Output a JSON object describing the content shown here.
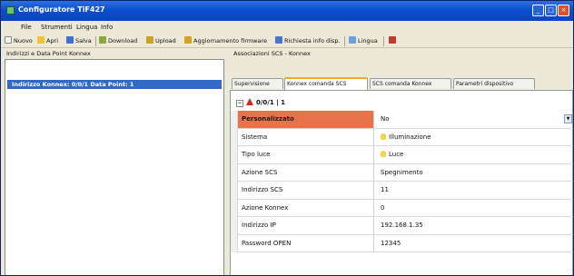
{
  "window": {
    "title": "Configuratore TiF427"
  },
  "menu": [
    "File",
    "Strumenti",
    "Lingua",
    "Info"
  ],
  "toolbar": [
    {
      "label": "Nuovo",
      "icon": "new-icon",
      "color": "#f2f2f2"
    },
    {
      "label": "Apri",
      "icon": "open-folder-icon",
      "color": "#f1c232"
    },
    {
      "label": "Salva",
      "icon": "save-icon",
      "color": "#3d6fd4"
    },
    {
      "label": "Download",
      "icon": "download-icon",
      "color": "#8aa83c"
    },
    {
      "label": "Upload",
      "icon": "upload-icon",
      "color": "#c9a227"
    },
    {
      "label": "Aggiornamento firmware",
      "icon": "firmware-icon",
      "color": "#d8a020"
    },
    {
      "label": "Richiesta info disp.",
      "icon": "info-request-icon",
      "color": "#4a74c9"
    },
    {
      "label": "Lingua",
      "icon": "language-icon",
      "color": "#6aa0e0"
    },
    {
      "label": "",
      "icon": "app-logo-icon",
      "color": "#c23b2a"
    }
  ],
  "left_panel": {
    "header": "Indirizzi e Data Point Konnex",
    "selected_item": "Indirizzo Konnex: 0/0/1 Data Point: 1"
  },
  "right_panel": {
    "header": "Associazioni SCS - Konnex",
    "tabs": [
      {
        "label": "Supervisione",
        "active": false
      },
      {
        "label": "Konnex comanda SCS",
        "active": true
      },
      {
        "label": "SCS comanda Konnex",
        "active": false
      },
      {
        "label": "Parametri dispositivo",
        "active": false
      }
    ],
    "group_label": "0/0/1 | 1",
    "rows": [
      {
        "key": "Personalizzato",
        "value": "No",
        "highlight": true,
        "dropdown": true
      },
      {
        "key": "Sistema",
        "value": "Illuminazione",
        "icon": "bulb-icon"
      },
      {
        "key": "Tipo luce",
        "value": "Luce",
        "icon": "bulb-icon"
      },
      {
        "key": "Azione SCS",
        "value": "Spegnimento"
      },
      {
        "key": "Indirizzo SCS",
        "value": "11"
      },
      {
        "key": "Azione Konnex",
        "value": "0"
      },
      {
        "key": "Indirizzo IP",
        "value": "192.168.1.35"
      },
      {
        "key": "Password OPEN",
        "value": "12345"
      }
    ]
  },
  "colors": {
    "titlebar": "#0a4fd0",
    "selection": "#316ac5",
    "highlight_row": "#e8734a",
    "active_tab_accent": "#f0a830"
  }
}
